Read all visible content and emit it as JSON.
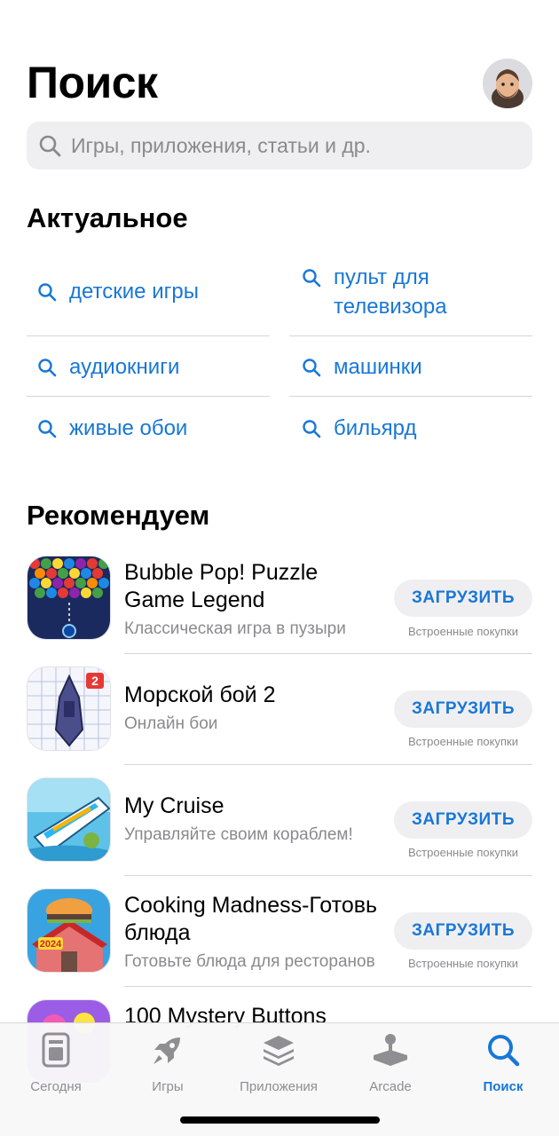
{
  "header": {
    "title": "Поиск"
  },
  "search": {
    "placeholder": "Игры, приложения, статьи и др."
  },
  "trending": {
    "title": "Актуальное",
    "items": [
      {
        "label": "детские игры"
      },
      {
        "label": "пульт для телевизора"
      },
      {
        "label": "аудиокниги"
      },
      {
        "label": "машинки"
      },
      {
        "label": "живые обои"
      },
      {
        "label": "бильярд"
      }
    ]
  },
  "recommended": {
    "title": "Рекомендуем",
    "get_label": "ЗАГРУЗИТЬ",
    "iap_label": "Встроенные покупки",
    "apps": [
      {
        "name": "Bubble Pop! Puzzle Game Legend",
        "subtitle": "Классическая игра в пузыри"
      },
      {
        "name": "Морской бой 2",
        "subtitle": "Онлайн бои"
      },
      {
        "name": "My Cruise",
        "subtitle": "Управляйте своим кораблем!"
      },
      {
        "name": "Cooking Madness-Готовь блюда",
        "subtitle": "Готовьте блюда для ресторанов"
      },
      {
        "name": "100 Mystery Buttons",
        "subtitle": ""
      }
    ]
  },
  "tabbar": {
    "tabs": [
      {
        "label": "Сегодня",
        "icon": "today-icon"
      },
      {
        "label": "Игры",
        "icon": "rocket-icon"
      },
      {
        "label": "Приложения",
        "icon": "apps-stack-icon"
      },
      {
        "label": "Arcade",
        "icon": "joystick-icon"
      },
      {
        "label": "Поиск",
        "icon": "search-icon",
        "active": true
      }
    ]
  },
  "colors": {
    "accent": "#1877d6",
    "secondary_text": "#8a8a8e",
    "button_bg": "#efeff2"
  }
}
